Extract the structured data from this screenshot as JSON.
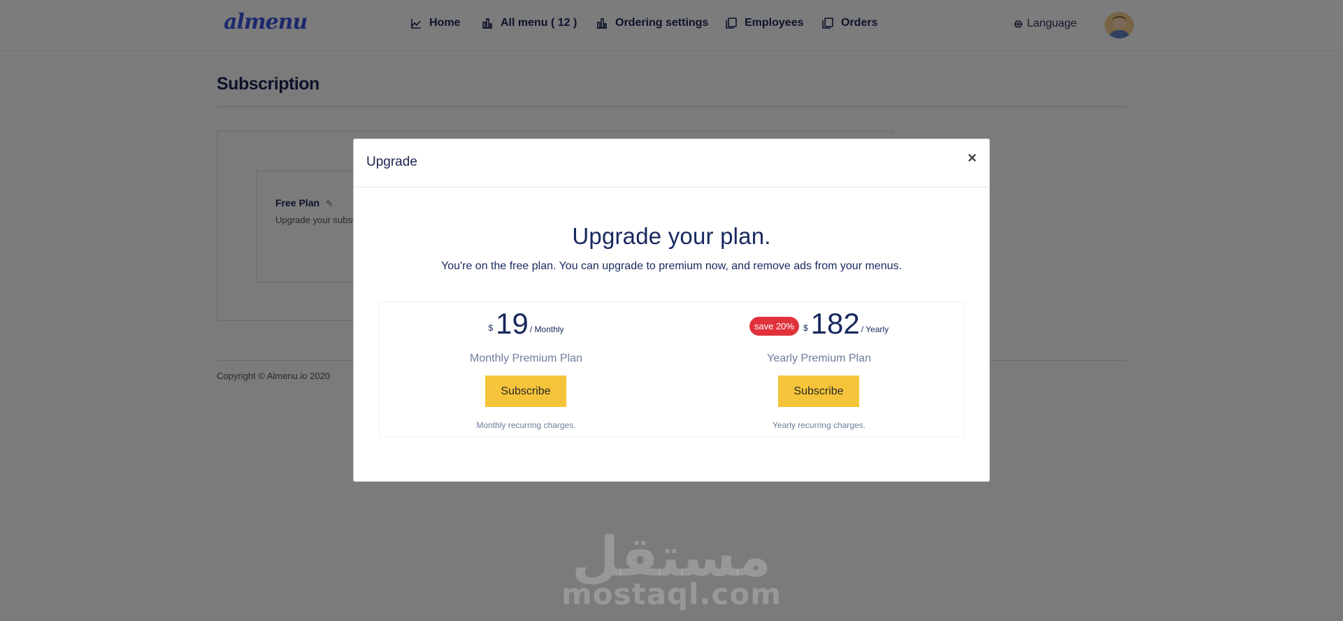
{
  "app": {
    "logo": "almenu"
  },
  "nav": {
    "items": [
      {
        "label": "Home",
        "icon": "chart-icon"
      },
      {
        "label": "All menu ( 12 )",
        "icon": "bar-chart-icon"
      },
      {
        "label": "Ordering settings",
        "icon": "bar-chart-icon"
      },
      {
        "label": "Employees",
        "icon": "copy-icon"
      },
      {
        "label": "Orders",
        "icon": "copy-icon"
      }
    ],
    "language": "Language"
  },
  "page": {
    "title": "Subscription",
    "current_plan": {
      "name": "Free Plan",
      "description": "Upgrade your subsc"
    },
    "copyright": "Copyright © Almenu.io 2020"
  },
  "modal": {
    "title": "Upgrade",
    "close": "×",
    "headline": "Upgrade your plan.",
    "subline": "You're on the free plan. You can upgrade to premium now, and remove ads from your menus.",
    "plans": [
      {
        "currency": "$",
        "amount": "19",
        "period": "/ Monthly",
        "badge": "",
        "name": "Monthly Premium Plan",
        "button": "Subscribe",
        "note": "Monthly recurring charges."
      },
      {
        "currency": "$",
        "amount": "182",
        "period": "/ Yearly",
        "badge": "save 20%",
        "name": "Yearly Premium Plan",
        "button": "Subscribe",
        "note": "Yearly recurring charges."
      }
    ]
  },
  "watermark": {
    "arabic": "مستقل",
    "latin": "mostaql.com"
  },
  "colors": {
    "brand": "#3a50d9",
    "navy": "#18285e",
    "subscribe_button": "#f5c43a",
    "save_badge": "#e1323b",
    "overlay": "rgba(0,0,0,0.5)"
  }
}
